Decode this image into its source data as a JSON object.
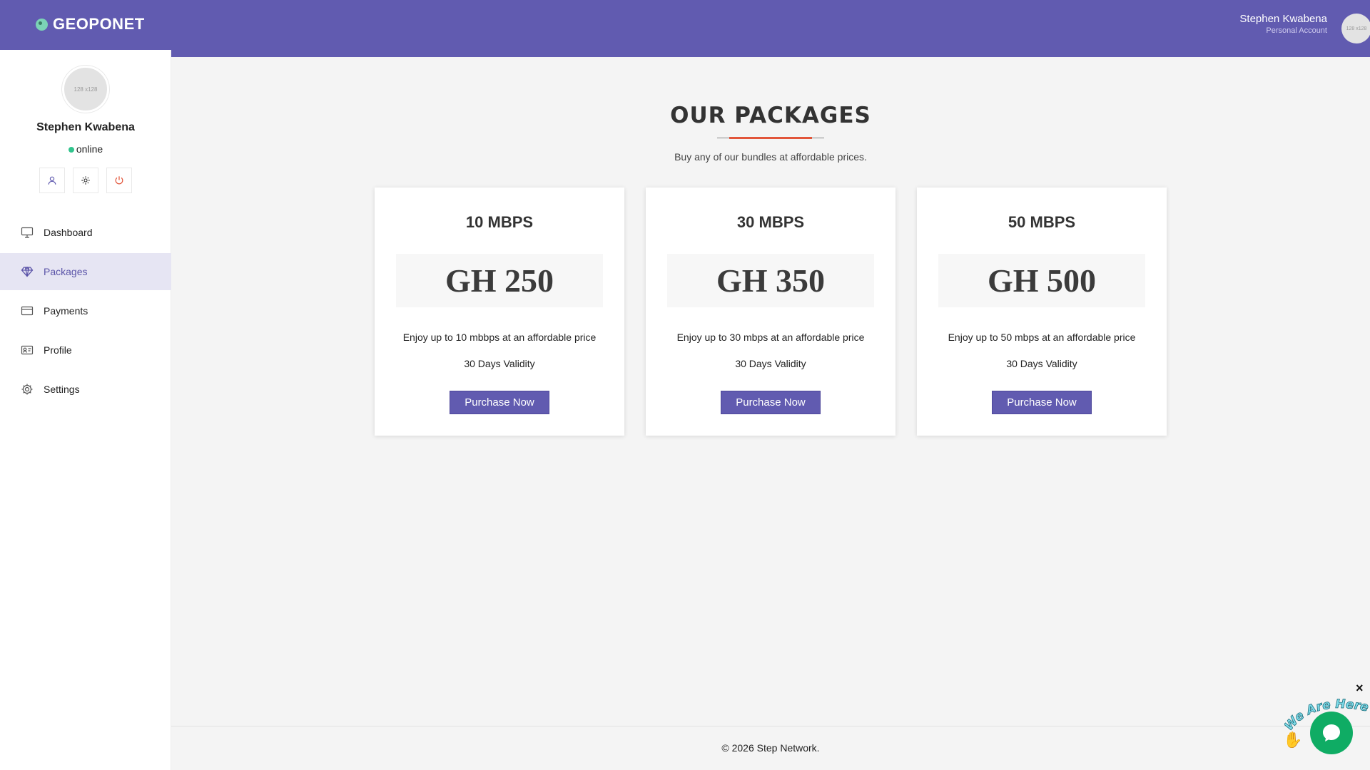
{
  "header": {
    "brand": "GEOPONET",
    "user_name": "Stephen Kwabena",
    "user_sub": "Personal Account",
    "avatar_text": "128 x128"
  },
  "sidebar": {
    "avatar_text": "128 x128",
    "user_name": "Stephen Kwabena",
    "status": "online",
    "actions": [
      {
        "icon": "user-icon"
      },
      {
        "icon": "gear-icon"
      },
      {
        "icon": "power-icon"
      }
    ],
    "items": [
      {
        "label": "Dashboard",
        "icon": "monitor-icon"
      },
      {
        "label": "Packages",
        "icon": "diamond-icon",
        "active": true
      },
      {
        "label": "Payments",
        "icon": "credit-card-icon"
      },
      {
        "label": "Profile",
        "icon": "id-card-icon"
      },
      {
        "label": "Settings",
        "icon": "gear-icon"
      }
    ]
  },
  "main": {
    "title": "OUR PACKAGES",
    "subtitle": "Buy any of our bundles at affordable prices.",
    "packages": [
      {
        "name": "10 MBPS",
        "price": "GH 250",
        "description": "Enjoy up to 10 mbbps at an affordable price",
        "validity": "30 Days Validity",
        "button": "Purchase Now"
      },
      {
        "name": "30 MBPS",
        "price": "GH 350",
        "description": "Enjoy up to 30 mbps at an affordable price",
        "validity": "30 Days Validity",
        "button": "Purchase Now"
      },
      {
        "name": "50 MBPS",
        "price": "GH 500",
        "description": "Enjoy up to 50 mbps at an affordable price",
        "validity": "30 Days Validity",
        "button": "Purchase Now"
      }
    ]
  },
  "footer": {
    "text": "© 2026 Step Network."
  },
  "chat": {
    "tag": "We Are Here!",
    "close": "×"
  },
  "colors": {
    "header": "#615bb0",
    "accent": "#e2553a",
    "active_bg": "#e6e5f3",
    "online": "#31c48d",
    "chat": "#0fac64"
  }
}
